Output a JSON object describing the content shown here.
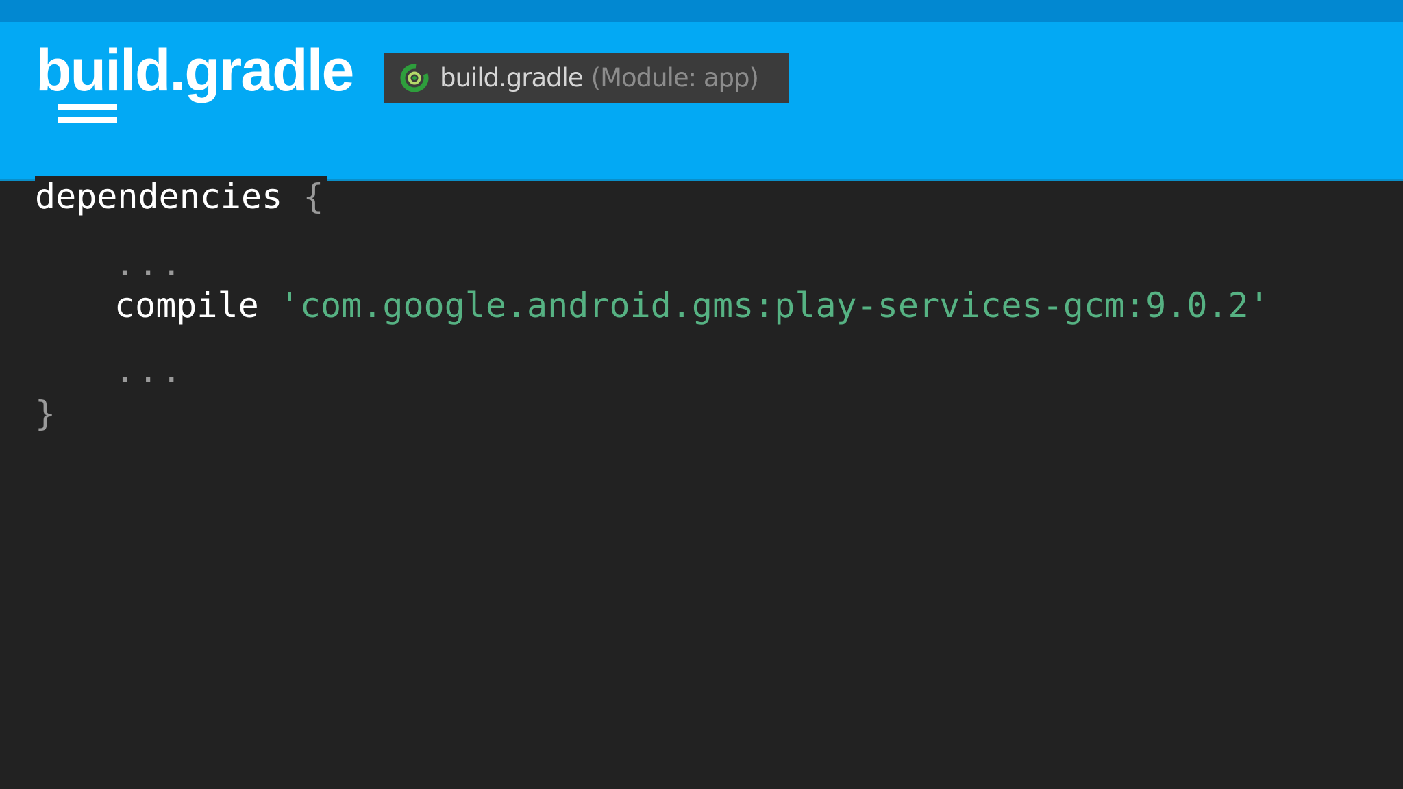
{
  "header": {
    "title": "build.gradle",
    "tab": {
      "icon": "gradle-icon",
      "file_name": "build.gradle",
      "module_label": "(Module: app)"
    }
  },
  "code": {
    "line1_keyword": "dependencies",
    "line1_brace": "{",
    "line2": "...",
    "line3_keyword": "compile",
    "line3_string": "'com.google.android.gms:play-services-gcm:9.0.2'",
    "line4": "...",
    "line5": "}"
  },
  "colors": {
    "header_bg": "#03a9f4",
    "top_strip": "#0288d1",
    "code_bg": "#222222",
    "string": "#56b283",
    "punctuation": "#9a9a9a"
  }
}
